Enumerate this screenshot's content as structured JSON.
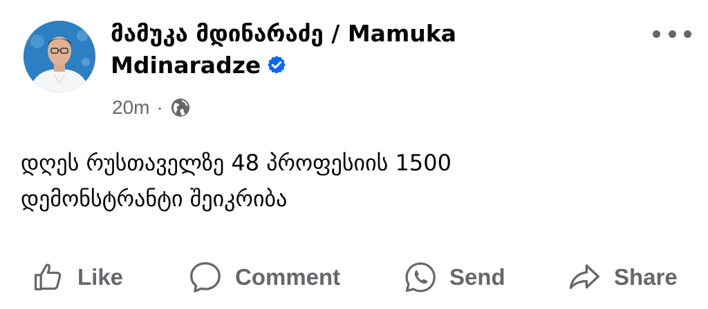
{
  "post": {
    "author_name": "მამუკა მდინარაძე / Mamuka Mdinaradze",
    "verified_icon": "verified-badge-icon",
    "timestamp": "20m",
    "separator": "·",
    "audience_icon": "globe-icon",
    "more_icon": "more-options-icon",
    "text_line1": "დღეს რუსთაველზე 48 პროფესიის 1500",
    "text_line2": "დემონსტრანტი შეიკრიბა"
  },
  "actions": {
    "like_label": "Like",
    "comment_label": "Comment",
    "send_label": "Send",
    "share_label": "Share"
  },
  "colors": {
    "text": "#050505",
    "secondary": "#65676b",
    "verified": "#0866ff",
    "background": "#ffffff"
  }
}
